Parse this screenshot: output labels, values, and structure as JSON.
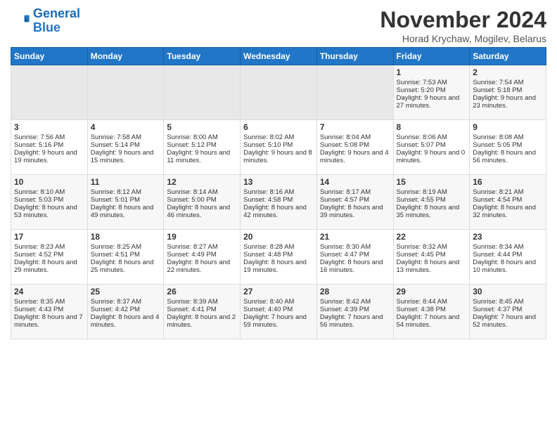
{
  "logo": {
    "line1": "General",
    "line2": "Blue"
  },
  "title": "November 2024",
  "subtitle": "Horad Krychaw, Mogilev, Belarus",
  "weekdays": [
    "Sunday",
    "Monday",
    "Tuesday",
    "Wednesday",
    "Thursday",
    "Friday",
    "Saturday"
  ],
  "weeks": [
    [
      {
        "day": "",
        "empty": true
      },
      {
        "day": "",
        "empty": true
      },
      {
        "day": "",
        "empty": true
      },
      {
        "day": "",
        "empty": true
      },
      {
        "day": "",
        "empty": true
      },
      {
        "day": "1",
        "sunrise": "Sunrise: 7:53 AM",
        "sunset": "Sunset: 5:20 PM",
        "daylight": "Daylight: 9 hours and 27 minutes."
      },
      {
        "day": "2",
        "sunrise": "Sunrise: 7:54 AM",
        "sunset": "Sunset: 5:18 PM",
        "daylight": "Daylight: 9 hours and 23 minutes."
      }
    ],
    [
      {
        "day": "3",
        "sunrise": "Sunrise: 7:56 AM",
        "sunset": "Sunset: 5:16 PM",
        "daylight": "Daylight: 9 hours and 19 minutes."
      },
      {
        "day": "4",
        "sunrise": "Sunrise: 7:58 AM",
        "sunset": "Sunset: 5:14 PM",
        "daylight": "Daylight: 9 hours and 15 minutes."
      },
      {
        "day": "5",
        "sunrise": "Sunrise: 8:00 AM",
        "sunset": "Sunset: 5:12 PM",
        "daylight": "Daylight: 9 hours and 11 minutes."
      },
      {
        "day": "6",
        "sunrise": "Sunrise: 8:02 AM",
        "sunset": "Sunset: 5:10 PM",
        "daylight": "Daylight: 9 hours and 8 minutes."
      },
      {
        "day": "7",
        "sunrise": "Sunrise: 8:04 AM",
        "sunset": "Sunset: 5:08 PM",
        "daylight": "Daylight: 9 hours and 4 minutes."
      },
      {
        "day": "8",
        "sunrise": "Sunrise: 8:06 AM",
        "sunset": "Sunset: 5:07 PM",
        "daylight": "Daylight: 9 hours and 0 minutes."
      },
      {
        "day": "9",
        "sunrise": "Sunrise: 8:08 AM",
        "sunset": "Sunset: 5:05 PM",
        "daylight": "Daylight: 8 hours and 56 minutes."
      }
    ],
    [
      {
        "day": "10",
        "sunrise": "Sunrise: 8:10 AM",
        "sunset": "Sunset: 5:03 PM",
        "daylight": "Daylight: 8 hours and 53 minutes."
      },
      {
        "day": "11",
        "sunrise": "Sunrise: 8:12 AM",
        "sunset": "Sunset: 5:01 PM",
        "daylight": "Daylight: 8 hours and 49 minutes."
      },
      {
        "day": "12",
        "sunrise": "Sunrise: 8:14 AM",
        "sunset": "Sunset: 5:00 PM",
        "daylight": "Daylight: 8 hours and 46 minutes."
      },
      {
        "day": "13",
        "sunrise": "Sunrise: 8:16 AM",
        "sunset": "Sunset: 4:58 PM",
        "daylight": "Daylight: 8 hours and 42 minutes."
      },
      {
        "day": "14",
        "sunrise": "Sunrise: 8:17 AM",
        "sunset": "Sunset: 4:57 PM",
        "daylight": "Daylight: 8 hours and 39 minutes."
      },
      {
        "day": "15",
        "sunrise": "Sunrise: 8:19 AM",
        "sunset": "Sunset: 4:55 PM",
        "daylight": "Daylight: 8 hours and 35 minutes."
      },
      {
        "day": "16",
        "sunrise": "Sunrise: 8:21 AM",
        "sunset": "Sunset: 4:54 PM",
        "daylight": "Daylight: 8 hours and 32 minutes."
      }
    ],
    [
      {
        "day": "17",
        "sunrise": "Sunrise: 8:23 AM",
        "sunset": "Sunset: 4:52 PM",
        "daylight": "Daylight: 8 hours and 29 minutes."
      },
      {
        "day": "18",
        "sunrise": "Sunrise: 8:25 AM",
        "sunset": "Sunset: 4:51 PM",
        "daylight": "Daylight: 8 hours and 25 minutes."
      },
      {
        "day": "19",
        "sunrise": "Sunrise: 8:27 AM",
        "sunset": "Sunset: 4:49 PM",
        "daylight": "Daylight: 8 hours and 22 minutes."
      },
      {
        "day": "20",
        "sunrise": "Sunrise: 8:28 AM",
        "sunset": "Sunset: 4:48 PM",
        "daylight": "Daylight: 8 hours and 19 minutes."
      },
      {
        "day": "21",
        "sunrise": "Sunrise: 8:30 AM",
        "sunset": "Sunset: 4:47 PM",
        "daylight": "Daylight: 8 hours and 16 minutes."
      },
      {
        "day": "22",
        "sunrise": "Sunrise: 8:32 AM",
        "sunset": "Sunset: 4:45 PM",
        "daylight": "Daylight: 8 hours and 13 minutes."
      },
      {
        "day": "23",
        "sunrise": "Sunrise: 8:34 AM",
        "sunset": "Sunset: 4:44 PM",
        "daylight": "Daylight: 8 hours and 10 minutes."
      }
    ],
    [
      {
        "day": "24",
        "sunrise": "Sunrise: 8:35 AM",
        "sunset": "Sunset: 4:43 PM",
        "daylight": "Daylight: 8 hours and 7 minutes."
      },
      {
        "day": "25",
        "sunrise": "Sunrise: 8:37 AM",
        "sunset": "Sunset: 4:42 PM",
        "daylight": "Daylight: 8 hours and 4 minutes."
      },
      {
        "day": "26",
        "sunrise": "Sunrise: 8:39 AM",
        "sunset": "Sunset: 4:41 PM",
        "daylight": "Daylight: 8 hours and 2 minutes."
      },
      {
        "day": "27",
        "sunrise": "Sunrise: 8:40 AM",
        "sunset": "Sunset: 4:40 PM",
        "daylight": "Daylight: 7 hours and 59 minutes."
      },
      {
        "day": "28",
        "sunrise": "Sunrise: 8:42 AM",
        "sunset": "Sunset: 4:39 PM",
        "daylight": "Daylight: 7 hours and 56 minutes."
      },
      {
        "day": "29",
        "sunrise": "Sunrise: 8:44 AM",
        "sunset": "Sunset: 4:38 PM",
        "daylight": "Daylight: 7 hours and 54 minutes."
      },
      {
        "day": "30",
        "sunrise": "Sunrise: 8:45 AM",
        "sunset": "Sunset: 4:37 PM",
        "daylight": "Daylight: 7 hours and 52 minutes."
      }
    ]
  ]
}
